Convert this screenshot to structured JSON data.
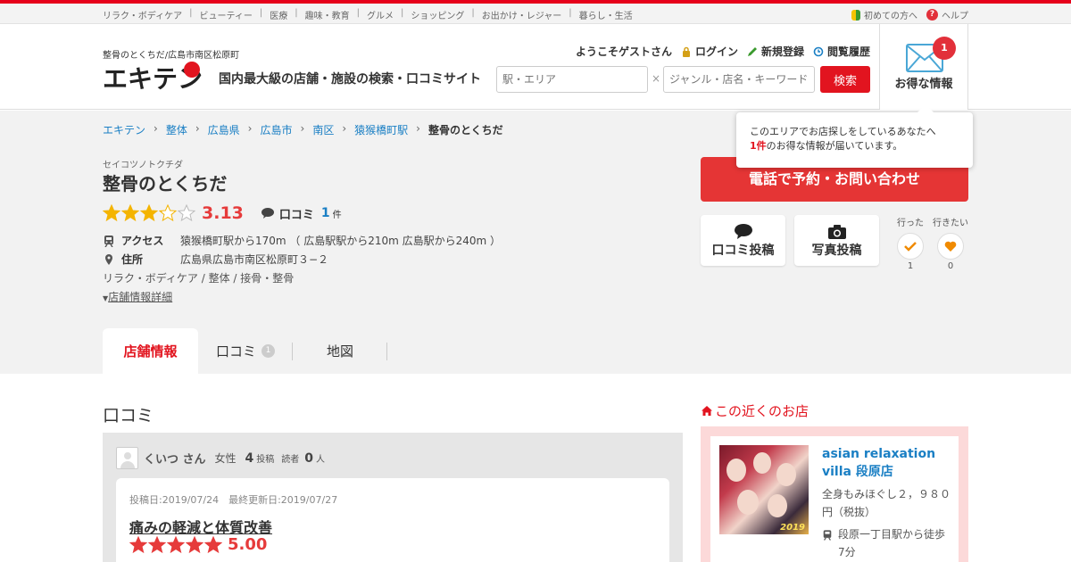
{
  "topbar": {
    "categories": [
      "リラク・ボディケア",
      "ビューティー",
      "医療",
      "趣味・教育",
      "グルメ",
      "ショッピング",
      "お出かけ・レジャー",
      "暮らし・生活"
    ],
    "first_time": "初めての方へ",
    "help": "ヘルプ"
  },
  "header": {
    "site_sub": "整骨のとくちだ/広島市南区松原町",
    "logo_text": "エキテン",
    "tagline": "国内最大級の店舗・施設の検索・口コミサイト",
    "welcome": "ようこそゲストさん",
    "login": "ログイン",
    "register": "新規登録",
    "history": "閲覧履歴",
    "search_area_placeholder": "駅・エリア",
    "search_x": "×",
    "search_genre_placeholder": "ジャンル・店名・キーワード",
    "search_button": "検索",
    "deals_label": "お得な情報",
    "deals_badge": "1"
  },
  "popup": {
    "line1": "このエリアでお店探しをしているあなたへ",
    "count": "1件",
    "line2": "のお得な情報が届いています。"
  },
  "breadcrumb": [
    "エキテン",
    "整体",
    "広島県",
    "広島市",
    "南区",
    "猿猴橋町駅",
    "整骨のとくちだ"
  ],
  "shop": {
    "kana": "セイコツノトクチダ",
    "name": "整骨のとくちだ",
    "rating": 3.13,
    "rating_text": "3.13",
    "review_label": "口コミ",
    "review_count": "1",
    "review_unit": "件",
    "access_label": "アクセス",
    "access_value": "猿猴橋町駅から170m （ 広島駅駅から210m 広島駅から240m ）",
    "address_label": "住所",
    "address_value": "広島県広島市南区松原町３−２",
    "genre": "リラク・ボディケア / 整体 / 接骨・整骨",
    "detail_link": "店舗情報詳細"
  },
  "actions": {
    "call": "電話で予約・お問い合わせ",
    "post_review": "口コミ投稿",
    "post_photo": "写真投稿",
    "went_label": "行った",
    "went_count": "1",
    "want_label": "行きたい",
    "want_count": "0"
  },
  "tabs": {
    "info": "店舗情報",
    "reviews": "口コミ",
    "reviews_badge": "1",
    "map": "地図"
  },
  "reviews_section": {
    "title": "口コミ",
    "reviewer_name": "くいつ さん",
    "reviewer_gender": "女性",
    "posts_count": "4",
    "posts_unit": "投稿",
    "readers_label": "読者",
    "readers_count": "0",
    "readers_unit": "人",
    "date": "投稿日:2019/07/24　最終更新日:2019/07/27",
    "review_title": "痛みの軽減と体質改善",
    "review_rating": 5.0,
    "review_score": "5.00"
  },
  "nearby": {
    "title": "この近くのお店",
    "shop_name": "asian relaxation villa 段原店",
    "desc": "全身もみほぐし２，９８０円（税抜）",
    "access": "段原一丁目駅から徒歩7分",
    "photo_year": "2019"
  },
  "colors": {
    "brand_red": "#e2141f",
    "star": "#f4b400",
    "link_blue": "#1a7fc4",
    "score_red": "#e63b3b"
  }
}
